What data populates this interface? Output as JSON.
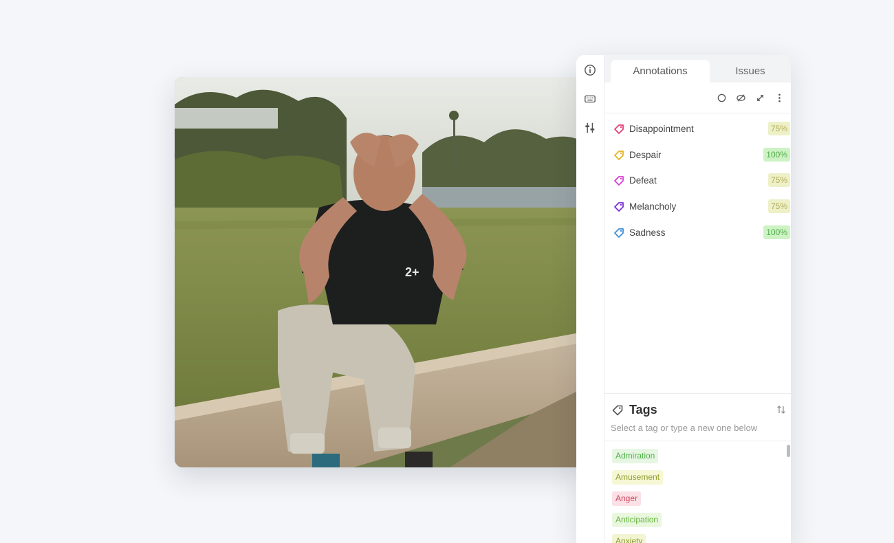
{
  "photo": {
    "alt_icon": "photo-scene"
  },
  "rail": {
    "icons": [
      "info-icon",
      "keyboard-icon",
      "sliders-icon"
    ]
  },
  "tabs": [
    {
      "label": "Annotations",
      "active": true
    },
    {
      "label": "Issues",
      "active": false
    }
  ],
  "toolbar": {
    "icons": [
      "circle-icon",
      "eye-off-icon",
      "expand-icon",
      "more-vertical-icon"
    ]
  },
  "annotations": [
    {
      "label": "Disappointment",
      "percent": "75%",
      "color": "#e0407a"
    },
    {
      "label": "Despair",
      "percent": "100%",
      "color": "#e6b422"
    },
    {
      "label": "Defeat",
      "percent": "75%",
      "color": "#d63fd1"
    },
    {
      "label": "Melancholy",
      "percent": "75%",
      "color": "#7a2fd6"
    },
    {
      "label": "Sadness",
      "percent": "100%",
      "color": "#3c8fd8"
    }
  ],
  "tags": {
    "title": "Tags",
    "hint": "Select a tag or type a new one below",
    "items": [
      {
        "label": "Admiration",
        "bg": "#e6f6e2",
        "fg": "#4fb14a"
      },
      {
        "label": "Amusement",
        "bg": "#f6f7d5",
        "fg": "#8f9a2a"
      },
      {
        "label": "Anger",
        "bg": "#fbe0e6",
        "fg": "#d0475f"
      },
      {
        "label": "Anticipation",
        "bg": "#eaf7df",
        "fg": "#62b33a"
      },
      {
        "label": "Anxiety",
        "bg": "#f3f5d2",
        "fg": "#8a9a2a"
      }
    ]
  }
}
